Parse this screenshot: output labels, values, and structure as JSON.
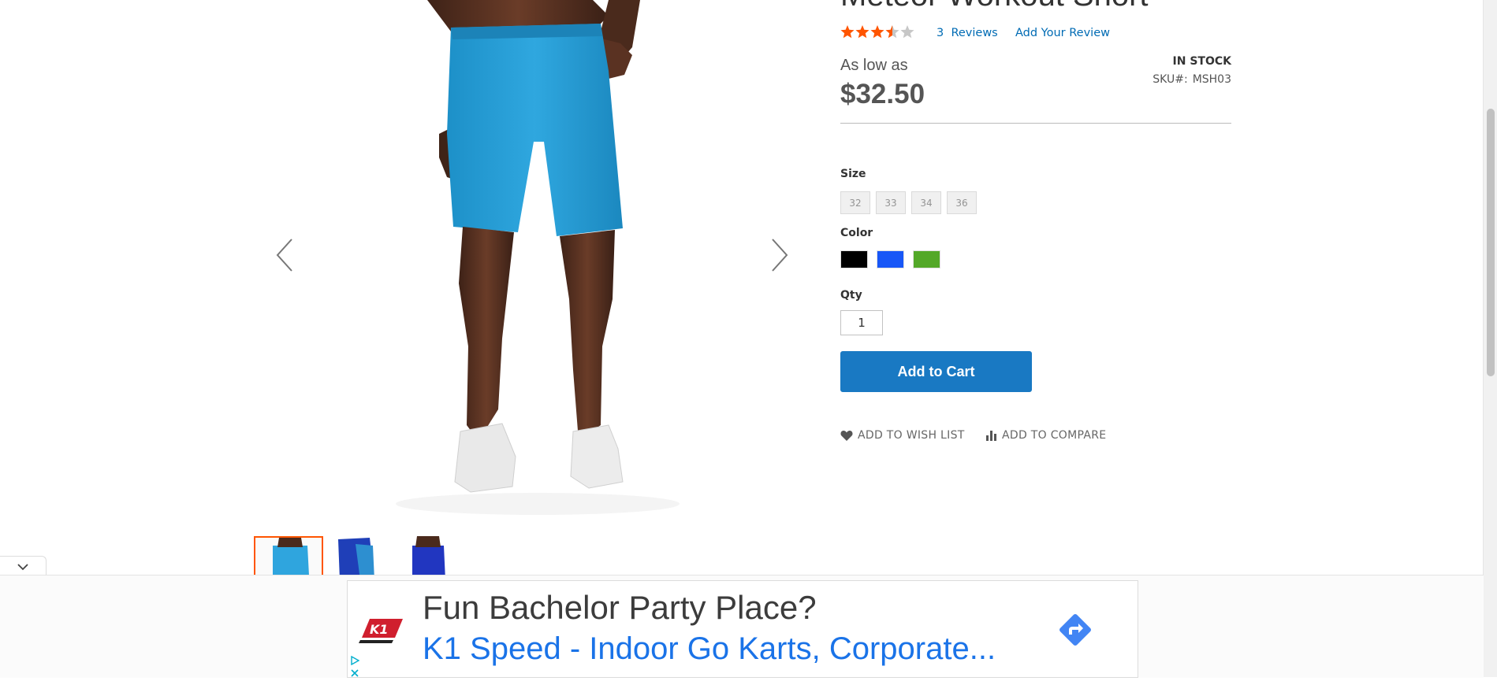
{
  "product": {
    "title": "Meteor Workout Short",
    "rating": 3.5,
    "rating_max": 5,
    "reviews_count": "3",
    "reviews_word": "Reviews",
    "add_review": "Add Your Review",
    "price_label": "As low as",
    "price": "$32.50",
    "stock": "IN STOCK",
    "sku_label": "SKU#:",
    "sku": "MSH03"
  },
  "options": {
    "size_label": "Size",
    "sizes": [
      "32",
      "33",
      "34",
      "36"
    ],
    "color_label": "Color",
    "colors": [
      {
        "name": "Black",
        "hex": "#000000"
      },
      {
        "name": "Blue",
        "hex": "#1857f7"
      },
      {
        "name": "Green",
        "hex": "#53a828"
      }
    ]
  },
  "qty": {
    "label": "Qty",
    "value": "1"
  },
  "actions": {
    "add_to_cart": "Add to Cart",
    "wish_list": "Add to Wish List",
    "compare": "Add to Compare"
  },
  "gallery": {
    "thumbnail_count": 3,
    "active_thumbnail": 0
  },
  "ad": {
    "headline": "Fun Bachelor Party Place?",
    "subline": "K1 Speed - Indoor Go Karts, Corporate...",
    "logo_text": "K1"
  },
  "colors": {
    "link": "#006bb4",
    "primary_button": "#1979c3",
    "star": "#ff5501",
    "active_thumb_border": "#ff5501"
  }
}
